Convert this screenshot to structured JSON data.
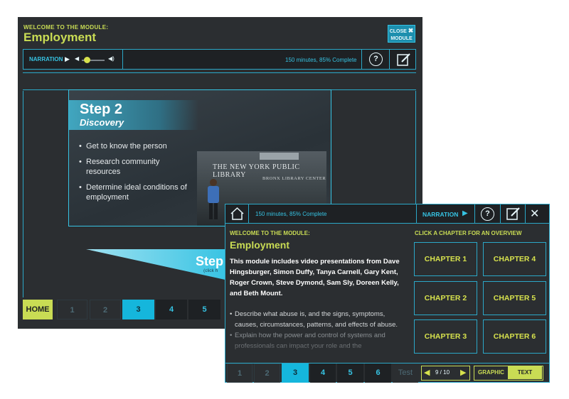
{
  "back": {
    "welcome": "WELCOME TO THE MODULE:",
    "title": "Employment",
    "close_line1": "CLOSE",
    "close_x": "✖",
    "close_line2": "MODULE",
    "narration": "NARRATION",
    "status": "150 minutes, 85% Complete",
    "volume_level": 0.15,
    "slide": {
      "heading": "Step 2",
      "subheading": "Discovery",
      "bullets": [
        "Get to know the person",
        "Research community resources",
        "Determine ideal conditions of employment"
      ],
      "photo_sign": "THE NEW YORK PUBLIC LIBRARY",
      "photo_sign2": "BRONX LIBRARY CENTER",
      "next_step_fragment": "Step",
      "click_fragment": "(click h"
    },
    "pager": [
      "HOME",
      "1",
      "2",
      "3",
      "4",
      "5"
    ],
    "active_page": "3"
  },
  "front": {
    "status": "150 minutes, 85% Complete",
    "narration": "NARRATION",
    "welcome": "WELCOME TO THE MODULE:",
    "title": "Employment",
    "intro": "This module includes video presentations from Dave Hingsburger, Simon Duffy, Tanya Carnell, Gary Kent, Roger Crown, Steve Dymond, Sam Sly, Doreen Kelly, and Beth Mount.",
    "bullets": [
      "Describe what abuse is, and the signs, symptoms, causes, circumstances, patterns, and effects of abuse.",
      "Explain how the power and control of systems and professionals can impact your role and the"
    ],
    "chapter_header": "CLICK A CHAPTER FOR AN OVERVIEW",
    "chapters": [
      "CHAPTER 1",
      "CHAPTER 2",
      "CHAPTER 3",
      "CHAPTER 4",
      "CHAPTER 5",
      "CHAPTER 6"
    ],
    "pager": [
      "1",
      "2",
      "3",
      "4",
      "5",
      "6",
      "Test"
    ],
    "active_page": "3",
    "page_indicator": "9 / 10",
    "toggle_graphic": "GRAPHIC",
    "toggle_text": "TEXT"
  },
  "colors": {
    "accent": "#36c3e3",
    "lime": "#c9dc54",
    "bg": "#2b2e31",
    "active": "#15b6dc"
  },
  "icons": {
    "home": "home-icon",
    "help": "question-icon",
    "notes": "notepad-pencil-icon",
    "close": "close-icon"
  }
}
